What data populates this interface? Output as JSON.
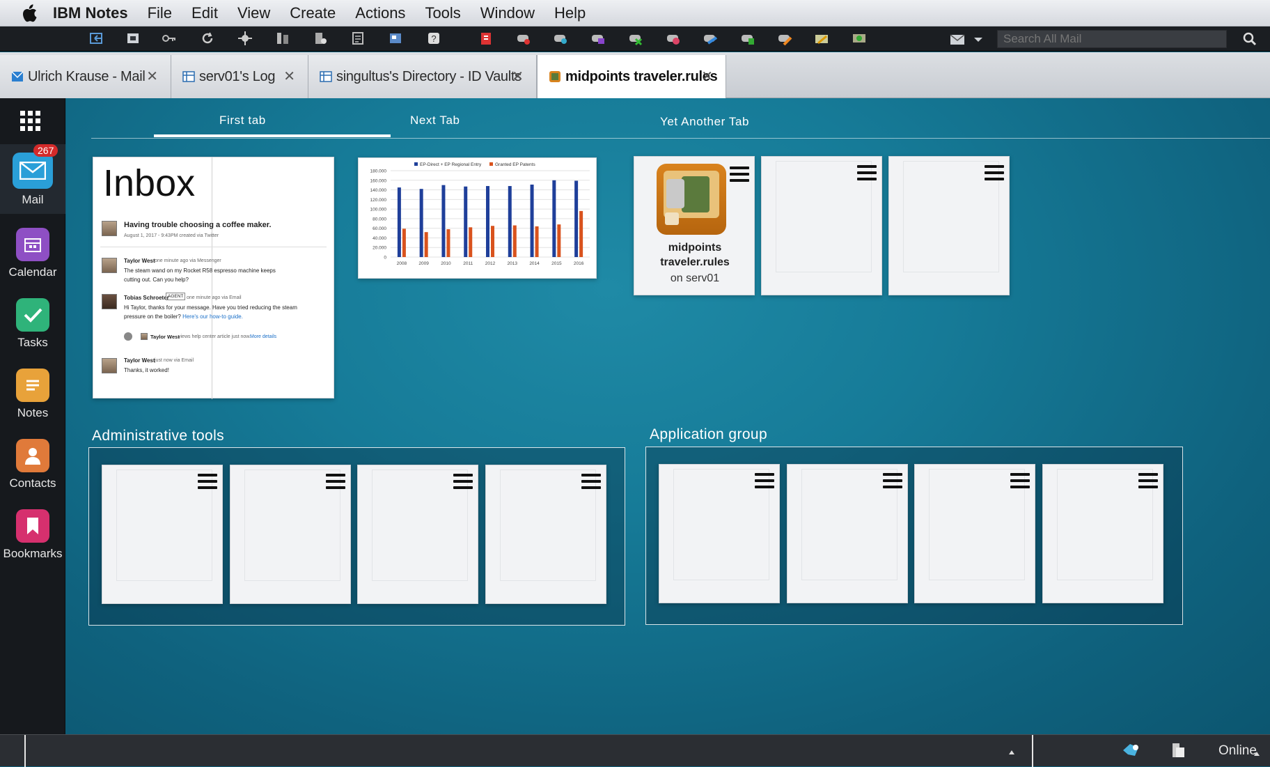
{
  "menubar": {
    "apple_icon": "apple-icon",
    "items": [
      "IBM Notes",
      "File",
      "Edit",
      "View",
      "Create",
      "Actions",
      "Tools",
      "Window",
      "Help"
    ]
  },
  "toolbar": {
    "search_placeholder": "Search All Mail",
    "icons": [
      "back-icon",
      "home-icon",
      "key-icon",
      "refresh-icon",
      "move-icon",
      "replicate-icon",
      "preferences-icon",
      "document-icon",
      "workspace-icon",
      "help-icon",
      "tool-red-icon",
      "tool-gamepad-icon",
      "tool-lightbulb-icon",
      "tool-purple-icon",
      "tool-green-icon",
      "tool-pink-icon",
      "tool-blue-icon",
      "tool-green2-icon",
      "tool-orange-icon",
      "tool-yellow-icon",
      "tool-olive-icon"
    ]
  },
  "doc_tabs": [
    {
      "label": "Ulrich Krause - Mail",
      "icon": "mail-icon"
    },
    {
      "label": "serv01's Log",
      "icon": "database-icon"
    },
    {
      "label": "singultus's Directory - ID Vaults",
      "icon": "database-icon"
    },
    {
      "label": "midpoints traveler.rules",
      "icon": "app-icon"
    }
  ],
  "sidebar": {
    "badge": "267",
    "items": [
      {
        "label": "Mail",
        "icon": "mail-icon",
        "color": "#2a9fd8"
      },
      {
        "label": "Calendar",
        "icon": "calendar-icon",
        "color": "#8e4fc4"
      },
      {
        "label": "Tasks",
        "icon": "checkmark-icon",
        "color": "#2fb37a"
      },
      {
        "label": "Notes",
        "icon": "notes-icon",
        "color": "#e8a23a"
      },
      {
        "label": "Contacts",
        "icon": "person-icon",
        "color": "#e07a3a"
      },
      {
        "label": "Bookmarks",
        "icon": "bookmark-icon",
        "color": "#d6306e"
      }
    ]
  },
  "workspace_tabs": [
    "First tab",
    "Next Tab",
    "Yet Another Tab"
  ],
  "inbox": {
    "title": "Inbox",
    "first_subject": "Having trouble choosing a coffee maker.",
    "first_meta": "August 1, 2017 - 9:43PM created via Twitter",
    "msg1_sender": "Taylor West",
    "msg1_meta": "one minute ago via Messenger",
    "msg1_text": "The steam wand on my Rocket R58 espresso machine keeps cutting out. Can you help?",
    "msg2_sender": "Tobias Schroeter",
    "msg2_tag": "AGENT",
    "msg2_meta": "one minute ago via Email",
    "msg2_text": "Hi Taylor, thanks for your message. Have you tried reducing the steam pressure on the boiler?",
    "msg2_link": "Here's our how-to guide.",
    "view_sender": "Taylor West",
    "view_text": "views help center article just now.",
    "view_link": "More details",
    "msg3_sender": "Taylor West",
    "msg3_meta": "just now via Email",
    "msg3_text": "Thanks, it worked!"
  },
  "chart_data": {
    "type": "bar",
    "categories": [
      "2008",
      "2009",
      "2010",
      "2011",
      "2012",
      "2013",
      "2014",
      "2015",
      "2016"
    ],
    "series": [
      {
        "name": "EP-Direct + EP Regional Entry",
        "values": [
          145000,
          142000,
          150000,
          147000,
          148000,
          148000,
          151000,
          160000,
          159000
        ],
        "color": "#1f3f9a"
      },
      {
        "name": "Granted EP Patents",
        "values": [
          59000,
          52000,
          58000,
          62000,
          65000,
          66000,
          64000,
          68000,
          96000
        ],
        "color": "#d9531e"
      }
    ],
    "yticks": [
      "0",
      "20.000",
      "40.000",
      "60.000",
      "80.000",
      "100.000",
      "120.000",
      "140.000",
      "160.000",
      "180.000"
    ],
    "ylim": [
      0,
      180000
    ]
  },
  "app_tile": {
    "title_line1": "midpoints",
    "title_line2": "traveler.rules",
    "server": "on serv01"
  },
  "groups": [
    {
      "title": "Administrative tools"
    },
    {
      "title": "Application group"
    }
  ],
  "status": {
    "online": "Online"
  }
}
